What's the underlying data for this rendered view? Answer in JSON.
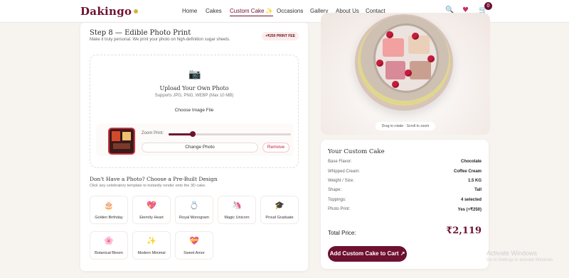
{
  "nav": {
    "logo": "Dakingo",
    "items": [
      "Home",
      "Cakes",
      "Custom Cake ✨",
      "Occasions",
      "Gallery",
      "About Us",
      "Contact"
    ],
    "cart_count": "0",
    "icons": [
      "search-icon",
      "heart-icon",
      "cart-icon"
    ]
  },
  "step": {
    "title": "Step 8 — Edible Photo Print",
    "subtitle": "Make it truly personal. We print your photo on high-definition sugar sheets.",
    "fee_badge": "+₹250 PRINT FEE"
  },
  "upload": {
    "title": "Upload Your Own Photo",
    "subtitle": "Supports JPG, PNG, WEBP (Max 10 MB)",
    "choose_label": "Choose Image File",
    "zoom_label": "Zoom Print:",
    "zoom_level": 0.2,
    "change_label": "Change Photo",
    "remove_label": "Remove"
  },
  "prebuilt": {
    "title": "Don't Have a Photo? Choose a Pre-Built Design",
    "subtitle": "Click any celebratory template to instantly render onto the 3D cake.",
    "designs": [
      {
        "label": "Golden Birthday",
        "icon": "🎂"
      },
      {
        "label": "Eternity Heart",
        "icon": "💖"
      },
      {
        "label": "Royal Monogram",
        "icon": "💍"
      },
      {
        "label": "Magic Unicorn",
        "icon": "🦄"
      },
      {
        "label": "Proud Graduate",
        "icon": "🎓"
      },
      {
        "label": "Botanical Bloom",
        "icon": "🌸"
      },
      {
        "label": "Modern Minimal",
        "icon": "✨"
      },
      {
        "label": "Sweet Amor",
        "icon": "💝"
      }
    ]
  },
  "preview": {
    "hint": "Drag to rotate · Scroll to zoom"
  },
  "summary": {
    "title": "Your Custom Cake",
    "rows": [
      {
        "key": "Base Flavor:",
        "value": "Chocolate"
      },
      {
        "key": "Whipped Cream:",
        "value": "Coffee Cream"
      },
      {
        "key": "Weight / Size:",
        "value": "1.5 KG"
      },
      {
        "key": "Shape:",
        "value": "Tall"
      },
      {
        "key": "Toppings:",
        "value": "4 selected"
      },
      {
        "key": "Photo Print:",
        "value": "Yes (+₹250)"
      }
    ],
    "total_label": "Total Price:",
    "total_value": "₹2,119",
    "add_label": "Add Custom Cake to Cart ↗"
  },
  "watermark": {
    "line1": "Activate Windows",
    "line2": "Go to Settings to activate Windows."
  },
  "colors": {
    "brand": "#6e1030",
    "accent_gold": "#d8b040",
    "remove_red": "#c02030"
  }
}
